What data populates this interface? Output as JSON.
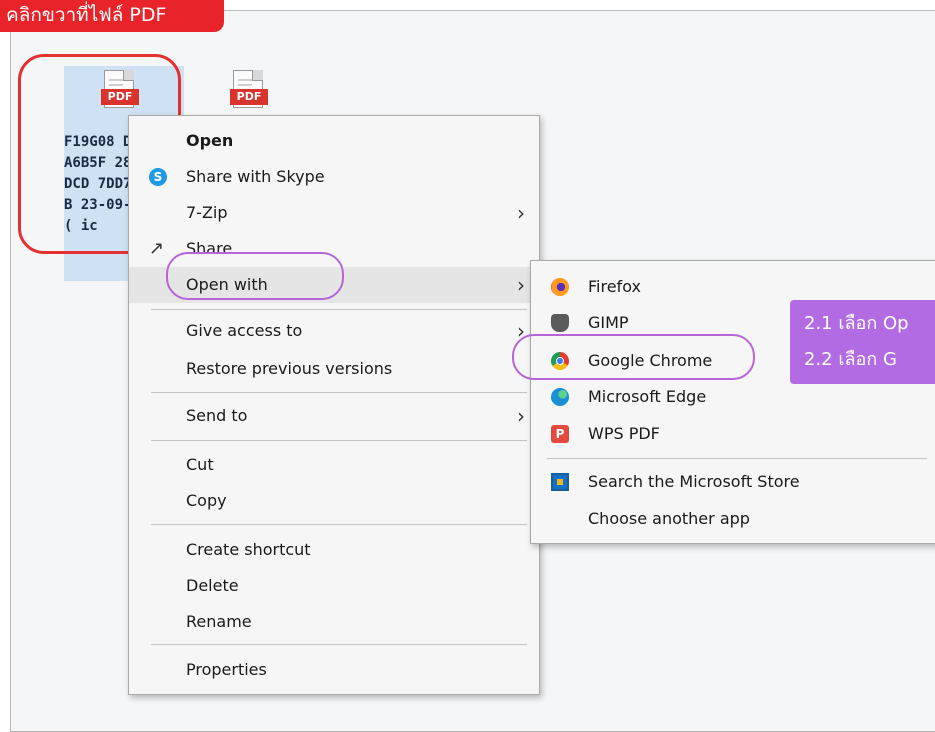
{
  "banner": "คลิกขวาที่ไฟล์ PDF",
  "files": [
    {
      "badge": "PDF",
      "name": "F19G08 DA6B5F 28DCD 7DD7B 23-09-( ic"
    },
    {
      "badge": "PDF",
      "name": ""
    }
  ],
  "context_menu": {
    "items": [
      {
        "label": "Open",
        "bold": true
      },
      {
        "label": "Share with Skype",
        "icon": "skype-icon"
      },
      {
        "label": "7-Zip",
        "submenu": true
      },
      {
        "label": "Share",
        "icon": "share-icon"
      },
      {
        "label": "Open with",
        "submenu": true,
        "highlighted": true
      },
      {
        "label": "Give access to",
        "submenu": true
      },
      {
        "label": "Restore previous versions"
      },
      {
        "label": "Send to",
        "submenu": true
      },
      {
        "label": "Cut"
      },
      {
        "label": "Copy"
      },
      {
        "label": "Create shortcut"
      },
      {
        "label": "Delete"
      },
      {
        "label": "Rename"
      },
      {
        "label": "Properties"
      }
    ]
  },
  "open_with_menu": {
    "items": [
      {
        "label": "Firefox",
        "icon": "firefox-icon"
      },
      {
        "label": "GIMP",
        "icon": "gimp-icon"
      },
      {
        "label": "Google Chrome",
        "icon": "chrome-icon",
        "highlighted": true
      },
      {
        "label": "Microsoft Edge",
        "icon": "edge-icon"
      },
      {
        "label": "WPS PDF",
        "icon": "wps-pdf-icon"
      },
      {
        "label": "Search the Microsoft Store",
        "icon": "microsoft-store-icon"
      },
      {
        "label": "Choose another app"
      }
    ]
  },
  "callout": {
    "line1": "2.1 เลือก Op",
    "line2": "2.2 เลือก G"
  },
  "colors": {
    "banner": "#e8232a",
    "selection_circle": "#e33131",
    "highlight_oval": "#b565d8",
    "callout": "#b36be3"
  }
}
